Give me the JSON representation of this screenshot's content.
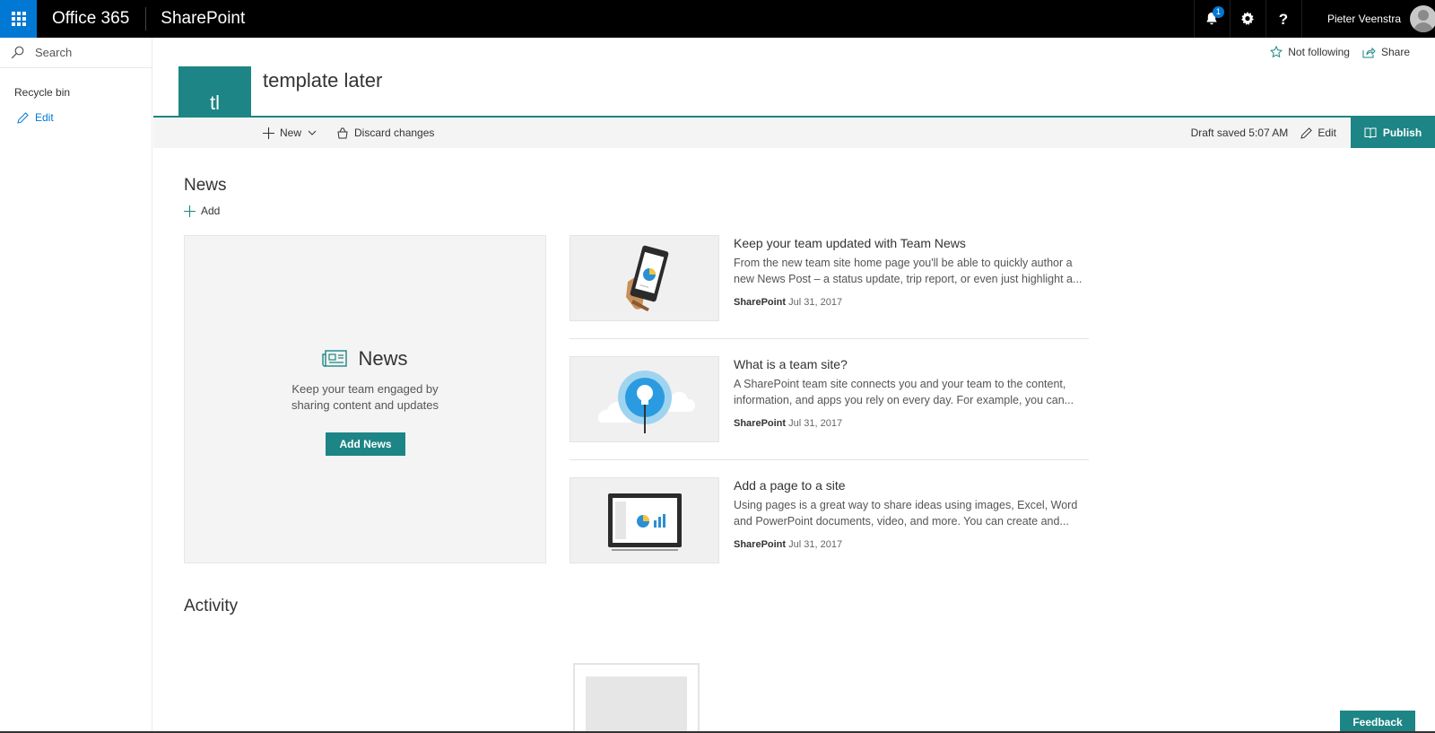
{
  "suite": {
    "brand": "Office 365",
    "app": "SharePoint",
    "notification_count": "1",
    "user_name": "Pieter Veenstra"
  },
  "leftnav": {
    "search_placeholder": "Search",
    "recycle_bin": "Recycle bin",
    "edit": "Edit"
  },
  "header": {
    "not_following": "Not following",
    "share": "Share",
    "site_initials": "tl",
    "site_title": "template later"
  },
  "commandbar": {
    "new": "New",
    "discard": "Discard changes",
    "draft_status": "Draft saved 5:07 AM",
    "edit": "Edit",
    "publish": "Publish"
  },
  "news": {
    "title": "News",
    "add": "Add",
    "placeholder_title": "News",
    "placeholder_desc": "Keep your team engaged by sharing content and updates",
    "add_news": "Add News",
    "items": [
      {
        "title": "Keep your team updated with Team News",
        "desc": "From the new team site home page you'll be able to quickly author a new News Post – a status update, trip report, or even just highlight a...",
        "author": "SharePoint",
        "date": "Jul 31, 2017",
        "thumb_icon": "phone-chart-icon"
      },
      {
        "title": "What is a team site?",
        "desc": "A SharePoint team site connects you and your team to the content, information, and apps you rely on every day. For example, you can...",
        "author": "SharePoint",
        "date": "Jul 31, 2017",
        "thumb_icon": "lightbulb-cloud-icon"
      },
      {
        "title": "Add a page to a site",
        "desc": "Using pages is a great way to share ideas using images, Excel, Word and PowerPoint documents, video, and more. You can create and...",
        "author": "SharePoint",
        "date": "Jul 31, 2017",
        "thumb_icon": "laptop-chart-icon"
      }
    ]
  },
  "activity": {
    "title": "Activity"
  },
  "feedback": "Feedback",
  "colors": {
    "accent": "#1d8585",
    "suitebar": "#000000",
    "waffle": "#0078d4"
  }
}
